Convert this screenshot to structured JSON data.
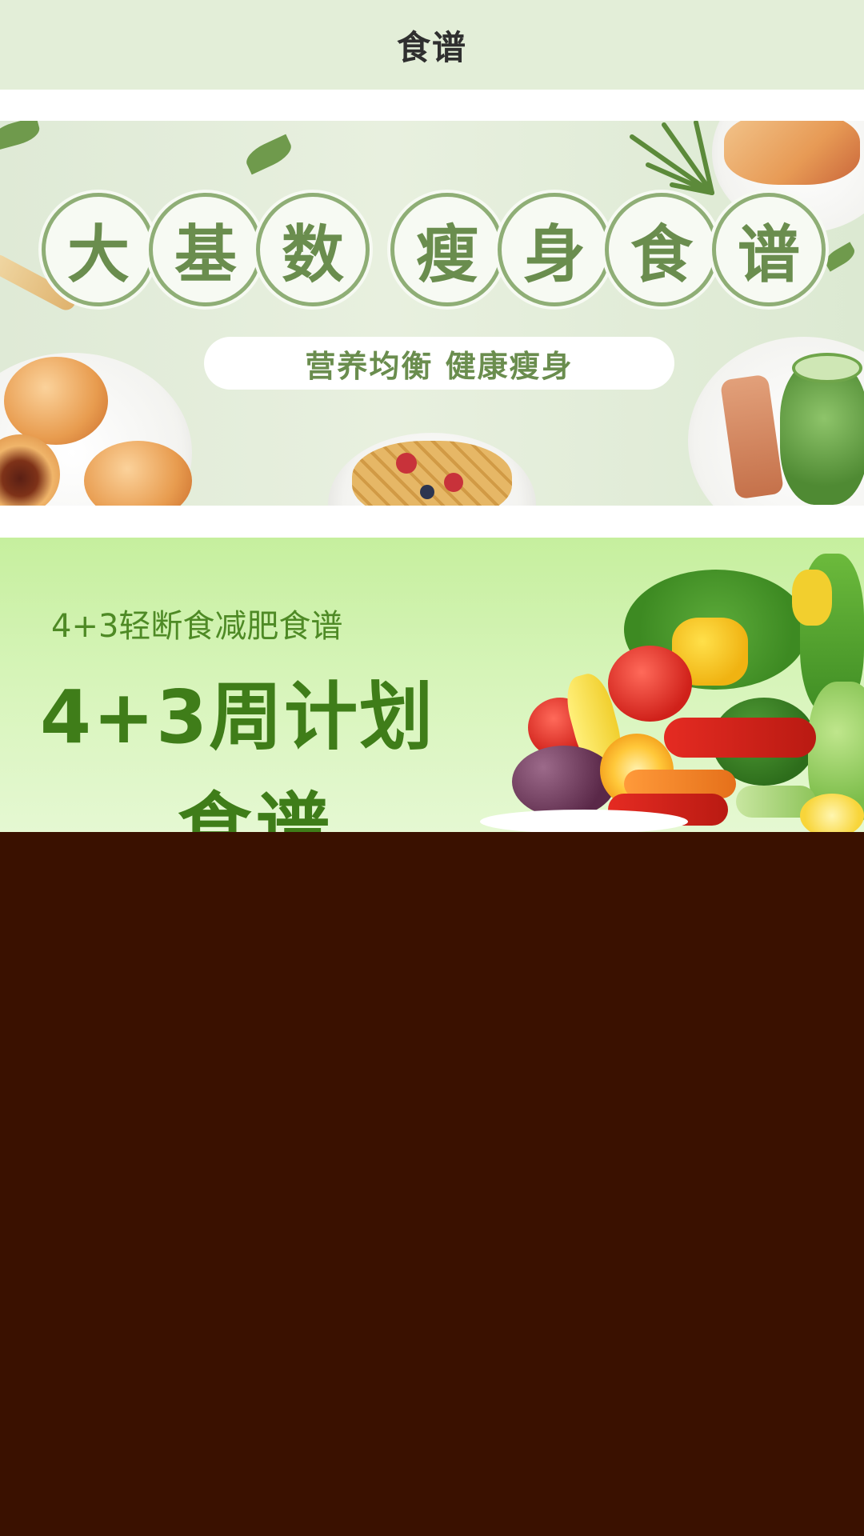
{
  "header": {
    "title": "食谱"
  },
  "banners": [
    {
      "title_group_1": [
        "大",
        "基",
        "数"
      ],
      "title_group_2": [
        "瘦",
        "身",
        "食",
        "谱"
      ],
      "subtitle": "营养均衡 健康瘦身"
    },
    {
      "small_title": "4+3轻断食减肥食谱",
      "big_title_line1": "4+3周计划",
      "big_title_line2": "食谱"
    }
  ],
  "colors": {
    "header_bg": "#e3eed8",
    "banner1_accent": "#6a8d4e",
    "banner2_accent": "#3f7d19",
    "dark_area": "#3a1100"
  }
}
